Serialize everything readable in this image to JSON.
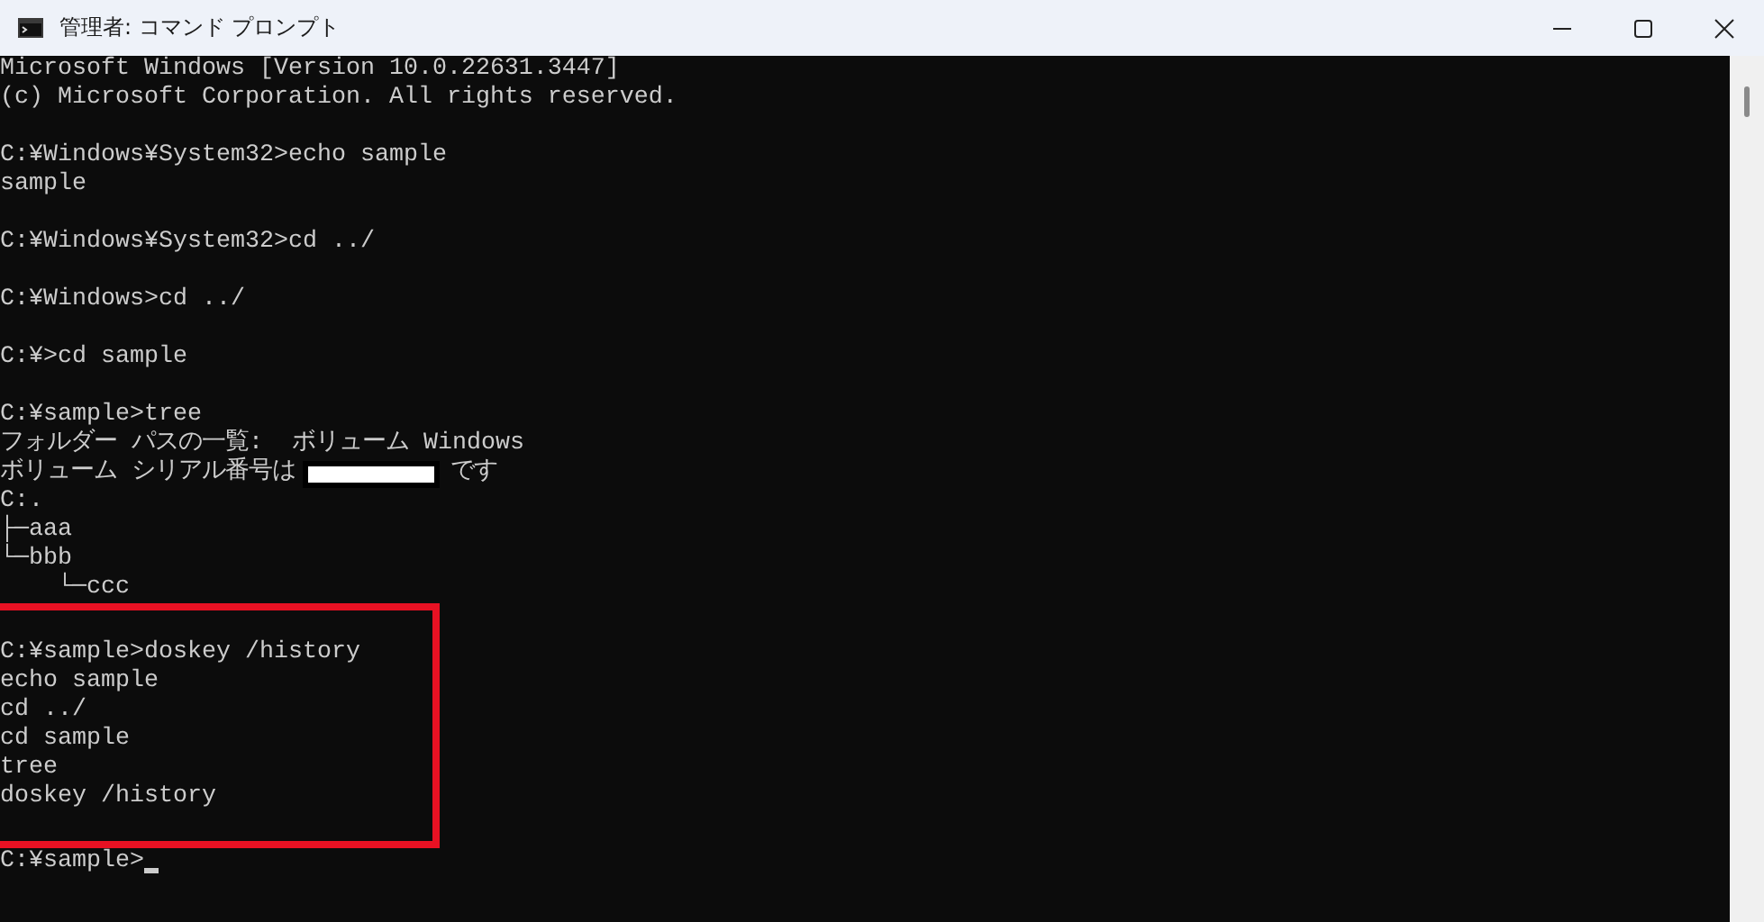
{
  "window": {
    "title": "管理者: コマンド プロンプト"
  },
  "console": {
    "blocks": [
      {
        "highlighted": false,
        "lines": [
          {
            "kind": "text",
            "text": "Microsoft Windows [Version 10.0.22631.3447]"
          },
          {
            "kind": "text",
            "text": "(c) Microsoft Corporation. All rights reserved."
          },
          {
            "kind": "blank"
          },
          {
            "kind": "text",
            "text": "C:¥Windows¥System32>echo sample"
          },
          {
            "kind": "text",
            "text": "sample"
          },
          {
            "kind": "blank"
          },
          {
            "kind": "text",
            "text": "C:¥Windows¥System32>cd ../"
          },
          {
            "kind": "blank"
          },
          {
            "kind": "text",
            "text": "C:¥Windows>cd ../"
          },
          {
            "kind": "blank"
          },
          {
            "kind": "text",
            "text": "C:¥>cd sample"
          },
          {
            "kind": "blank"
          },
          {
            "kind": "text",
            "text": "C:¥sample>tree"
          },
          {
            "kind": "text",
            "text": "フォルダー パスの一覧:  ボリューム Windows"
          },
          {
            "kind": "redacted",
            "before": "ボリューム シリアル番号は",
            "after": "です"
          },
          {
            "kind": "text",
            "text": "C:."
          },
          {
            "kind": "text",
            "text": "├─aaa"
          },
          {
            "kind": "text",
            "text": "└─bbb"
          },
          {
            "kind": "text",
            "text": "    └─ccc"
          }
        ]
      },
      {
        "highlighted": true,
        "lines": [
          {
            "kind": "blank"
          },
          {
            "kind": "text",
            "text": "C:¥sample>doskey /history"
          },
          {
            "kind": "text",
            "text": "echo sample"
          },
          {
            "kind": "text",
            "text": "cd ../"
          },
          {
            "kind": "text",
            "text": "cd sample"
          },
          {
            "kind": "text",
            "text": "tree"
          },
          {
            "kind": "text",
            "text": "doskey /history"
          },
          {
            "kind": "blank"
          }
        ]
      },
      {
        "highlighted": false,
        "lines": [
          {
            "kind": "prompt",
            "text": "C:¥sample>",
            "cursor": true
          }
        ]
      }
    ]
  }
}
